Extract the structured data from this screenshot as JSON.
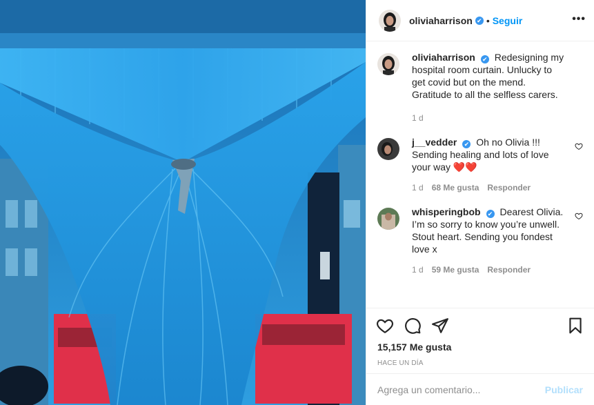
{
  "post": {
    "author": "oliviaharrison",
    "follow_label": "Seguir",
    "dot": "•",
    "more_label": "•••",
    "verified_mark": "✔"
  },
  "caption": {
    "username": "oliviaharrison",
    "text": "Redesigning my hospital room curtain. Unlucky to get covid but on the mend. Gratitude to all the selfless carers.",
    "time": "1 d"
  },
  "comments": [
    {
      "username": "j__vedder",
      "text": "Oh no Olivia !!! Sending healing and lots of love your way",
      "emoji": "❤️❤️",
      "time": "1 d",
      "likes": "68 Me gusta",
      "reply_label": "Responder"
    },
    {
      "username": "whisperingbob",
      "text": "Dearest Olivia. I’m so sorry to know you’re unwell. Stout heart. Sending you fondest love x",
      "emoji": "",
      "time": "1 d",
      "likes": "59 Me gusta",
      "reply_label": "Responder"
    }
  ],
  "stats": {
    "likes": "15,157 Me gusta",
    "posted_ago": "HACE UN DÍA"
  },
  "add_comment": {
    "placeholder": "Agrega un comentario...",
    "publish_label": "Publicar"
  },
  "icons": {
    "like": "heart-outline-icon",
    "comment": "speech-bubble-icon",
    "share": "paper-plane-icon",
    "save": "bookmark-icon"
  },
  "colors": {
    "accent": "#0095f6",
    "verified": "#3897f0",
    "publish_disabled": "#b2dffc",
    "curtain_blue": "#2aa8ee",
    "bus_red": "#e0304a"
  }
}
